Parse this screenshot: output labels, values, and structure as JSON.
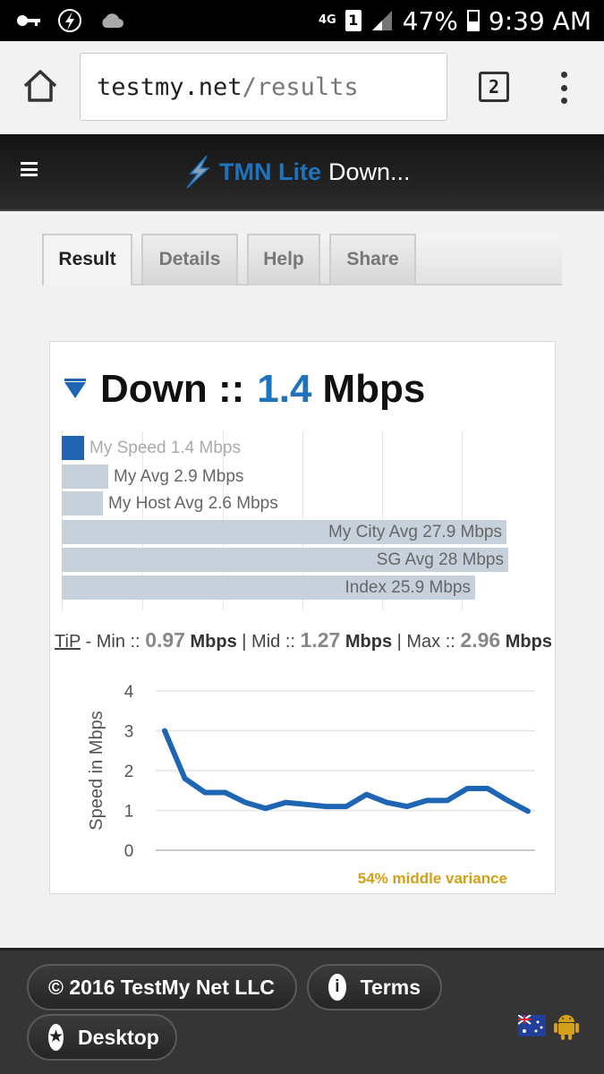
{
  "status_bar": {
    "network": "4G",
    "sim": "1",
    "battery": "47%",
    "time": "9:39 AM"
  },
  "browser": {
    "url_host": "testmy.net",
    "url_path": "/results",
    "tab_count": "2"
  },
  "site_header": {
    "brand_tmn": "TMN Lite",
    "brand_rest": "Down..."
  },
  "tabs": [
    {
      "label": "Result",
      "active": true
    },
    {
      "label": "Details",
      "active": false
    },
    {
      "label": "Help",
      "active": false
    },
    {
      "label": "Share",
      "active": false
    }
  ],
  "result": {
    "direction": "Down ::",
    "speed": "1.4",
    "unit": "Mbps",
    "comparison_bars": [
      {
        "label": "My Speed 1.4 Mbps",
        "value": 1.4,
        "mine": true
      },
      {
        "label": "My Avg 2.9 Mbps",
        "value": 2.9,
        "mine": false
      },
      {
        "label": "My Host Avg 2.6 Mbps",
        "value": 2.6,
        "mine": false
      },
      {
        "label": "My City Avg 27.9 Mbps",
        "value": 27.9,
        "mine": false
      },
      {
        "label": "SG Avg 28 Mbps",
        "value": 28,
        "mine": false
      },
      {
        "label": "Index 25.9 Mbps",
        "value": 25.9,
        "mine": false
      }
    ],
    "tip": {
      "tip_label": "TiP",
      "min_label": "- Min ::",
      "min_value": "0.97",
      "mid_label": "| Mid ::",
      "mid_value": "1.27",
      "max_label": "| Max ::",
      "max_value": "2.96",
      "unit": "Mbps"
    },
    "variance_text": "54% middle variance"
  },
  "chart_data": {
    "type": "line",
    "ylabel": "Speed in Mbps",
    "xlabel": "",
    "ylim": [
      0,
      4
    ],
    "yticks": [
      "0",
      "1",
      "2",
      "3",
      "4"
    ],
    "series": [
      {
        "values": [
          3.0,
          1.8,
          1.45,
          1.45,
          1.2,
          1.05,
          1.2,
          1.15,
          1.1,
          1.1,
          1.4,
          1.2,
          1.1,
          1.25,
          1.25,
          1.55,
          1.55,
          1.25,
          0.98
        ]
      }
    ],
    "grid": true,
    "color": "#1e66b3"
  },
  "footer": {
    "copyright": "© 2016 TestMy Net LLC",
    "terms": "Terms",
    "desktop": "Desktop"
  }
}
